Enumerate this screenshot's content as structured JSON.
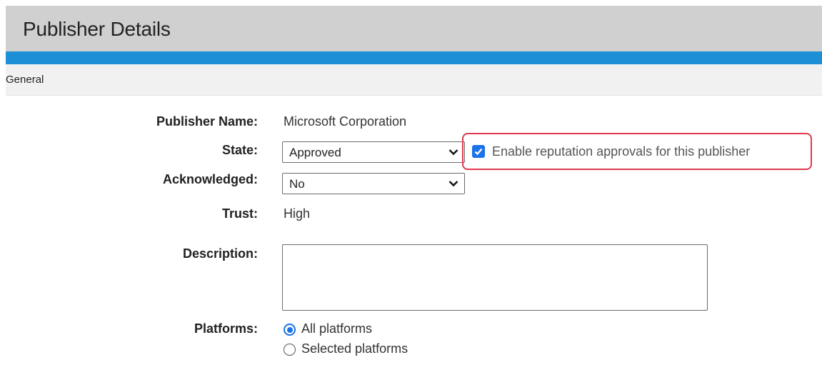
{
  "header": {
    "title": "Publisher Details"
  },
  "tabs": {
    "general": "General"
  },
  "form": {
    "publisher_name": {
      "label": "Publisher Name:",
      "value": "Microsoft Corporation"
    },
    "state": {
      "label": "State:",
      "value": "Approved"
    },
    "reputation": {
      "label": "Enable reputation approvals for this publisher",
      "checked": true
    },
    "acknowledged": {
      "label": "Acknowledged:",
      "value": "No"
    },
    "trust": {
      "label": "Trust:",
      "value": "High"
    },
    "description": {
      "label": "Description:",
      "value": ""
    },
    "platforms": {
      "label": "Platforms:",
      "options": [
        "All platforms",
        "Selected platforms"
      ],
      "selected": "All platforms"
    }
  },
  "colors": {
    "accent": "#1c8fd6",
    "header_bg": "#d0d0d0",
    "highlight": "#e0394d",
    "control_blue": "#1a73e8"
  }
}
